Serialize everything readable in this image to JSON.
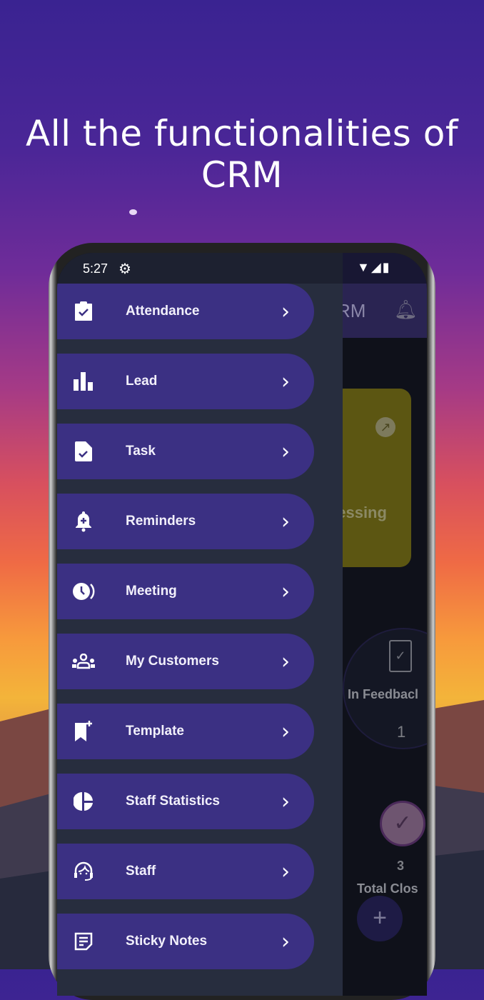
{
  "headline": "All the functionalities of CRM",
  "status_bar": {
    "time": "5:27",
    "settings_icon": "gear-icon",
    "wifi_icon": "wifi-icon",
    "signal_icon": "signal-icon",
    "battery_icon": "battery-icon"
  },
  "app": {
    "title_fragment": "RM",
    "bell_icon": "bell-icon"
  },
  "dashboard": {
    "card_text": "cessing\nd",
    "feedback_label": "In Feedbacl",
    "feedback_count": "1",
    "closed_count": "3",
    "closed_label": "Total Clos\n    ad",
    "fab_label": "+"
  },
  "drawer": {
    "items": [
      {
        "label": "Attendance",
        "icon": "clipboard-check-icon"
      },
      {
        "label": "Lead",
        "icon": "bar-chart-icon"
      },
      {
        "label": "Task",
        "icon": "file-check-icon"
      },
      {
        "label": "Reminders",
        "icon": "bell-plus-icon"
      },
      {
        "label": "Meeting",
        "icon": "clock-icon"
      },
      {
        "label": "My Customers",
        "icon": "group-icon"
      },
      {
        "label": "Template",
        "icon": "bookmark-plus-icon"
      },
      {
        "label": "Staff Statistics",
        "icon": "pie-chart-icon"
      },
      {
        "label": "Staff",
        "icon": "support-agent-icon"
      },
      {
        "label": "Sticky Notes",
        "icon": "sticky-note-icon"
      }
    ]
  },
  "colors": {
    "drawer_item": "#3b3083",
    "drawer_bg": "#272d3e",
    "header": "#2a2452"
  }
}
